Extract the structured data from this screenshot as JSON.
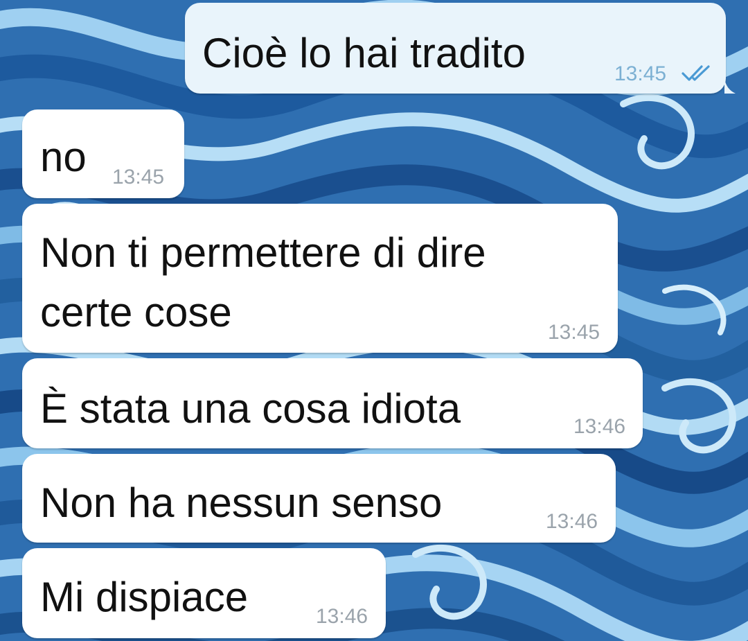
{
  "colors": {
    "incoming_bubble": "#ffffff",
    "outgoing_bubble": "#e9f4fb",
    "timestamp": "#9aa3ab",
    "outgoing_timestamp": "#7cb0d3",
    "read_ticks": "#4a9ad4",
    "wallpaper_dark": "#1c5a9c",
    "wallpaper_light": "#a9d3f2"
  },
  "messages": [
    {
      "direction": "outgoing",
      "lines": [
        "Cioè lo hai tradito"
      ],
      "time": "13:45",
      "status_icon": "double-check-icon"
    },
    {
      "direction": "incoming",
      "lines": [
        "no"
      ],
      "time": "13:45"
    },
    {
      "direction": "incoming",
      "lines": [
        "Non ti permettere di dire",
        "certe cose"
      ],
      "time": "13:45"
    },
    {
      "direction": "incoming",
      "lines": [
        "È stata una cosa idiota"
      ],
      "time": "13:46"
    },
    {
      "direction": "incoming",
      "lines": [
        "Non ha nessun senso"
      ],
      "time": "13:46"
    },
    {
      "direction": "incoming",
      "lines": [
        "Mi dispiace"
      ],
      "time": "13:46"
    }
  ]
}
